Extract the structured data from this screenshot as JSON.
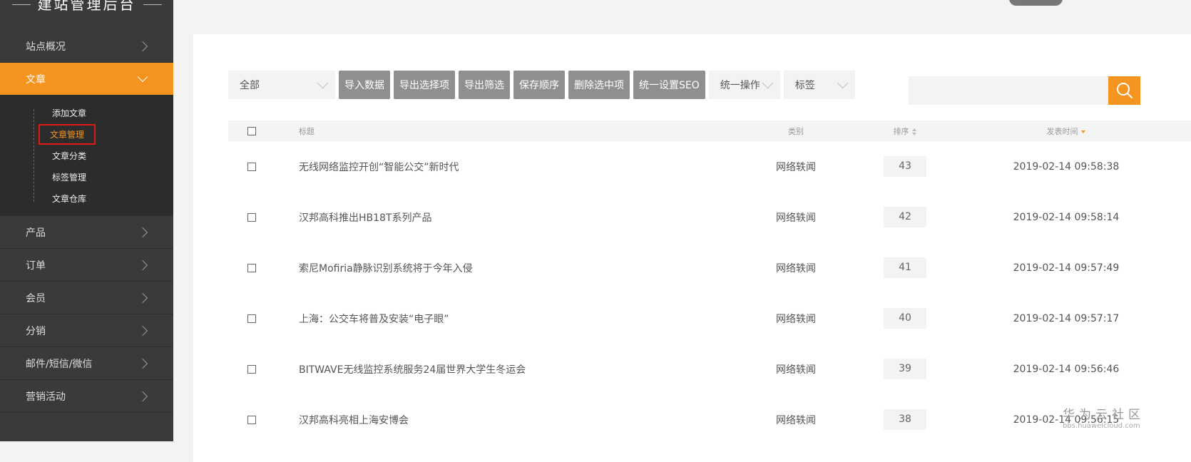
{
  "sidebar": {
    "brand": "建站管理后台",
    "items_top": [
      {
        "label": "站点概况"
      }
    ],
    "active_item": {
      "label": "文章"
    },
    "sub_items": [
      {
        "label": "添加文章"
      },
      {
        "label": "文章管理"
      },
      {
        "label": "文章分类"
      },
      {
        "label": "标签管理"
      },
      {
        "label": "文章仓库"
      }
    ],
    "items_bottom": [
      {
        "label": "产品"
      },
      {
        "label": "订单"
      },
      {
        "label": "会员"
      },
      {
        "label": "分销"
      },
      {
        "label": "邮件/短信/微信"
      },
      {
        "label": "营销活动"
      }
    ]
  },
  "toolbar": {
    "filter_select": "全部",
    "buttons": [
      "导入数据",
      "导出选择项",
      "导出筛选",
      "保存顺序",
      "删除选中项",
      "统一设置SEO"
    ],
    "batch_select": "统一操作",
    "tag_select": "标签",
    "search_placeholder": ""
  },
  "table": {
    "headers": {
      "title": "标题",
      "category": "类别",
      "sort": "排序",
      "date": "发表时间"
    },
    "rows": [
      {
        "title": "无线网络监控开创“智能公交”新时代",
        "category": "网络轶闻",
        "sort": "43",
        "date": "2019-02-14 09:58:38"
      },
      {
        "title": "汉邦高科推出HB18T系列产品",
        "category": "网络轶闻",
        "sort": "42",
        "date": "2019-02-14 09:58:14"
      },
      {
        "title": "索尼Mofiria静脉识别系统将于今年入侵",
        "category": "网络轶闻",
        "sort": "41",
        "date": "2019-02-14 09:57:49"
      },
      {
        "title": "上海：公交车将普及安装“电子眼”",
        "category": "网络轶闻",
        "sort": "40",
        "date": "2019-02-14 09:57:17"
      },
      {
        "title": "BITWAVE无线监控系统服务24届世界大学生冬运会",
        "category": "网络轶闻",
        "sort": "39",
        "date": "2019-02-14 09:56:46"
      },
      {
        "title": "汉邦高科亮相上海安博会",
        "category": "网络轶闻",
        "sort": "38",
        "date": "2019-02-14 09:56:15"
      }
    ]
  },
  "watermark": {
    "main": "华为云社区",
    "sub": "bbs.huaweicloud.com"
  },
  "colors": {
    "accent": "#f5941f",
    "sidebar_bg": "#3a3a3a",
    "button_gray": "#8f8f8f",
    "highlight_border": "#e01818"
  }
}
